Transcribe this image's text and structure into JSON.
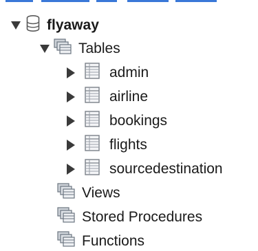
{
  "tree": {
    "schema": {
      "label": "flyaway",
      "expanded": true,
      "icon": "database-icon"
    },
    "tables_folder": {
      "label": "Tables",
      "expanded": true,
      "icon": "folder-icon"
    },
    "tables": [
      {
        "label": "admin",
        "icon": "table-icon"
      },
      {
        "label": "airline",
        "icon": "table-icon"
      },
      {
        "label": "bookings",
        "icon": "table-icon"
      },
      {
        "label": "flights",
        "icon": "table-icon"
      },
      {
        "label": "sourcedestination",
        "icon": "table-icon"
      }
    ],
    "views_folder": {
      "label": "Views",
      "icon": "folder-icon"
    },
    "procedures_folder": {
      "label": "Stored Procedures",
      "icon": "folder-icon"
    },
    "functions_folder": {
      "label": "Functions",
      "icon": "folder-icon"
    }
  },
  "colors": {
    "accent": "#3a78d8",
    "arrow": "#3a3a3a",
    "icon": "#6b7480"
  }
}
